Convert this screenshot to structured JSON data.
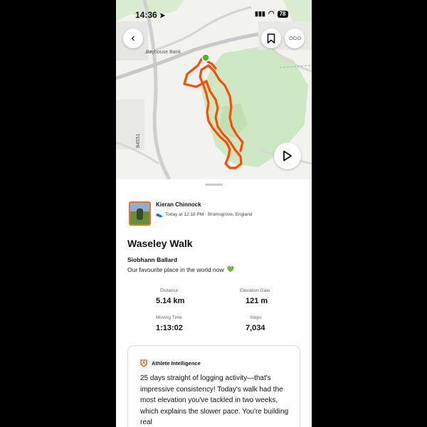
{
  "status_bar": {
    "time": "14:36",
    "battery": "78"
  },
  "map": {
    "label_top": "Bayhouse Bank",
    "label_road": "B4551"
  },
  "activity": {
    "athlete_name": "Kieran Chinnock",
    "meta": "Today at 12:18 PM · Bromsgrove, England",
    "title": "Waseley Walk",
    "companion": "Siobhann Ballard",
    "description": "Our favourite place in the world now",
    "description_emoji": "💚"
  },
  "stats": [
    {
      "label": "Distance",
      "value": "5.14 km"
    },
    {
      "label": "Elevation Gain",
      "value": "121 m"
    },
    {
      "label": "Moving Time",
      "value": "1:13:02"
    },
    {
      "label": "Steps",
      "value": "7,034"
    }
  ],
  "athlete_intelligence": {
    "title": "Athlete Intelligence",
    "body": "25 days straight of logging activity—that's impressive consistency! Today's walk had the most elevation you've tackled in two weeks, which explains the slower pace. You're building real"
  },
  "colors": {
    "route": "#fc4c02",
    "start_marker": "#4cbb17",
    "map_green": "#cfe8c4"
  },
  "icons": [
    "back-arrow-icon",
    "bookmark-icon",
    "more-dots-icon",
    "play-icon",
    "location-arrow-icon",
    "wifi-icon",
    "signal-icon",
    "shoe-icon",
    "athlete-intelligence-icon"
  ]
}
